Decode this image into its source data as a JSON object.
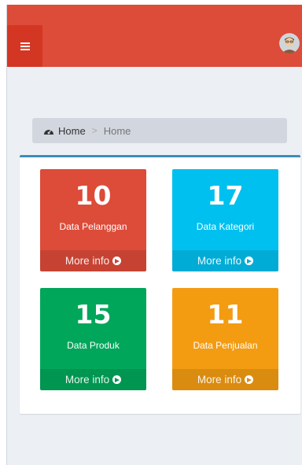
{
  "header": {
    "menu_icon": "hamburger-icon",
    "avatar_icon": "user-avatar"
  },
  "breadcrumb": {
    "icon": "dashboard-icon",
    "home": "Home",
    "separator": ">",
    "current": "Home"
  },
  "tiles": [
    {
      "count": "10",
      "label": "Data Pelanggan",
      "link": "More info",
      "color": "#dd4b39"
    },
    {
      "count": "17",
      "label": "Data Kategori",
      "link": "More info",
      "color": "#00c0ef"
    },
    {
      "count": "15",
      "label": "Data Produk",
      "link": "More info",
      "color": "#00a65a"
    },
    {
      "count": "11",
      "label": "Data Penjualan",
      "link": "More info",
      "color": "#f39c12"
    }
  ],
  "colors": {
    "header": "#dd4b39",
    "menu_button": "#d33724",
    "content_bg": "#ecf0f5",
    "panel_border": "#3c8dbc"
  }
}
